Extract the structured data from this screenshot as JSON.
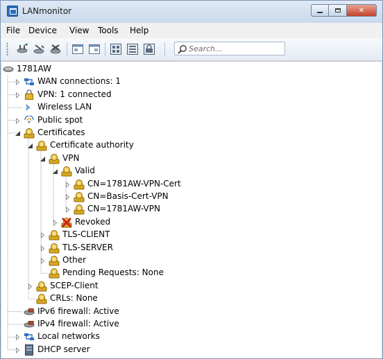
{
  "window": {
    "title": "LANmonitor",
    "min_glyph": "",
    "max_glyph": "",
    "close_glyph": "✕"
  },
  "menu": [
    "File",
    "Device",
    "View",
    "Tools",
    "Help"
  ],
  "toolbar": {
    "buttons": [
      "add-device-icon",
      "edit-device-icon",
      "delete-device-icon",
      "window-view-icon",
      "window-view-alt-icon",
      "calculator-icon",
      "list-view-icon",
      "firewall-icon"
    ],
    "search_placeholder": "Search..."
  },
  "tree": {
    "items": [
      {
        "label": "1781AW",
        "icon": "router-icon",
        "level": 0,
        "expander": "none"
      },
      {
        "label": "WAN connections: 1",
        "icon": "network-icon",
        "level": 1,
        "expander": "collapsed"
      },
      {
        "label": "VPN: 1 connected",
        "icon": "lock-icon",
        "level": 1,
        "expander": "collapsed"
      },
      {
        "label": "Wireless LAN",
        "icon": "wireless-icon",
        "level": 1,
        "expander": "none"
      },
      {
        "label": "Public spot",
        "icon": "public-spot-icon",
        "level": 1,
        "expander": "collapsed"
      },
      {
        "label": "Certificates",
        "icon": "certificate-icon",
        "level": 1,
        "expander": "expanded"
      },
      {
        "label": "Certificate authority",
        "icon": "certificate-icon",
        "level": 2,
        "expander": "expanded"
      },
      {
        "label": "VPN",
        "icon": "certificate-icon",
        "level": 3,
        "expander": "expanded"
      },
      {
        "label": "Valid",
        "icon": "certificate-icon",
        "level": 4,
        "expander": "expanded"
      },
      {
        "label": "CN=1781AW-VPN-Cert",
        "icon": "certificate-icon",
        "level": 5,
        "expander": "collapsed"
      },
      {
        "label": "CN=Basis-Cert-VPN",
        "icon": "certificate-icon",
        "level": 5,
        "expander": "collapsed"
      },
      {
        "label": "CN=1781AW-VPN",
        "icon": "certificate-icon",
        "level": 5,
        "expander": "collapsed"
      },
      {
        "label": "Revoked",
        "icon": "revoked-certificate-icon",
        "level": 4,
        "expander": "collapsed"
      },
      {
        "label": "TLS-CLIENT",
        "icon": "certificate-icon",
        "level": 3,
        "expander": "collapsed"
      },
      {
        "label": "TLS-SERVER",
        "icon": "certificate-icon",
        "level": 3,
        "expander": "collapsed"
      },
      {
        "label": "Other",
        "icon": "certificate-icon",
        "level": 3,
        "expander": "collapsed"
      },
      {
        "label": "Pending Requests: None",
        "icon": "certificate-icon",
        "level": 3,
        "expander": "none"
      },
      {
        "label": "SCEP-Client",
        "icon": "certificate-icon",
        "level": 2,
        "expander": "collapsed"
      },
      {
        "label": "CRLs: None",
        "icon": "certificate-icon",
        "level": 2,
        "expander": "none"
      },
      {
        "label": "IPv6 firewall: Active",
        "icon": "firewall-icon",
        "level": 1,
        "expander": "none"
      },
      {
        "label": "IPv4 firewall: Active",
        "icon": "firewall-icon",
        "level": 1,
        "expander": "none"
      },
      {
        "label": "Local networks",
        "icon": "network-icon",
        "level": 1,
        "expander": "collapsed"
      },
      {
        "label": "DHCP server",
        "icon": "server-icon",
        "level": 1,
        "expander": "collapsed"
      }
    ]
  },
  "colors": {
    "title_bg": "#cfdcec",
    "close_button": "#c7422a",
    "certificate_gold": "#e0b52a",
    "revoked_red": "#d32020",
    "network_blue": "#2f72c4",
    "router_gray": "#8a8a8a"
  }
}
